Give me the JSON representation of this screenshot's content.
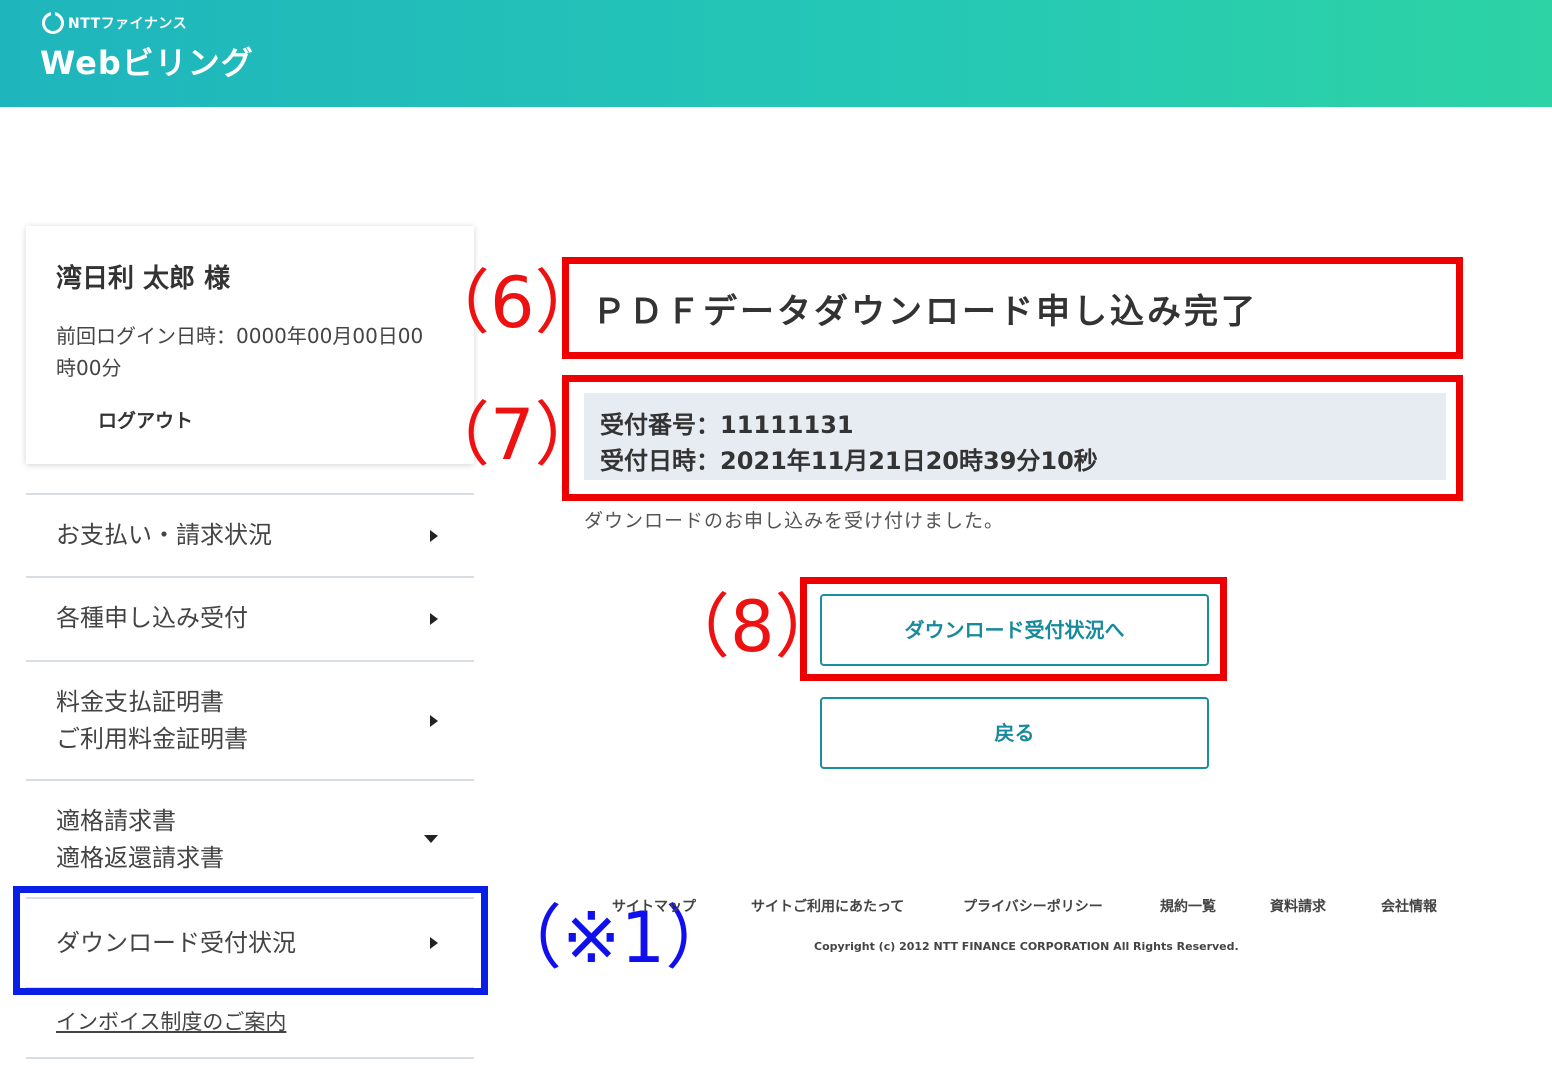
{
  "header": {
    "company": "NTTファイナンス",
    "service_name": "Webビリング"
  },
  "user": {
    "name": "湾日利 太郎 様",
    "last_login": "前回ログイン日時：0000年00月00日00時00分",
    "logout_label": "ログアウト"
  },
  "menu": {
    "items": [
      {
        "label": "お支払い・請求状況"
      },
      {
        "label": "各種申し込み受付"
      },
      {
        "label": "料金支払証明書",
        "label2": "ご利用料金証明書"
      },
      {
        "label": "適格請求書",
        "label2": "適格返還請求書"
      },
      {
        "label": "ダウンロード受付状況"
      }
    ],
    "invoice_link": "インボイス制度のご案内"
  },
  "main": {
    "title": "ＰＤＦデータダウンロード申し込み完了",
    "receipt_number": "受付番号：11111131",
    "receipt_datetime": "受付日時：2021年11月21日20時39分10秒",
    "message": "ダウンロードのお申し込みを受け付けました。",
    "status_button": "ダウンロード受付状況へ",
    "back_button": "戻る"
  },
  "annotations": {
    "a6": "（6）",
    "a7": "（7）",
    "a8": "（8）",
    "note1": "（※1）"
  },
  "footer": {
    "links": [
      "サイトマップ",
      "サイトご利用にあたって",
      "プライバシーポリシー",
      "規約一覧",
      "資料請求",
      "会社情報"
    ],
    "copyright": "Copyright (c) 2012 NTT FINANCE CORPORATION All Rights Reserved."
  }
}
